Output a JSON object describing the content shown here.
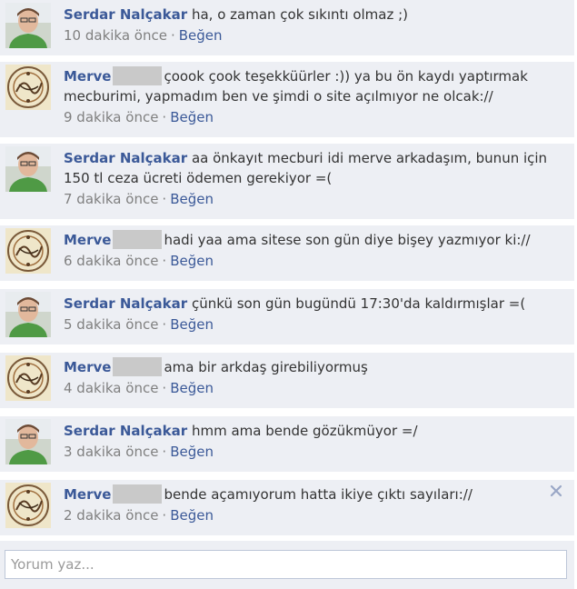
{
  "comments": [
    {
      "author": "Serdar Nalçakar",
      "avatar": "profile-photo-man-green-shirt",
      "redacted": false,
      "text": "ha, o zaman çok sıkıntı olmaz ;)",
      "time": "10 dakika önce",
      "separator": "·",
      "like": "Beğen"
    },
    {
      "author": "Merve",
      "avatar": "profile-photo-ornate-calligraphy",
      "redacted": true,
      "text": "çoook çook teşekküürler :)) ya bu ön kaydı yaptırmak mecburimi, yapmadım ben ve şimdi o site açılmıyor ne olcak://",
      "time": "9 dakika önce",
      "separator": "·",
      "like": "Beğen"
    },
    {
      "author": "Serdar Nalçakar",
      "avatar": "profile-photo-man-green-shirt",
      "redacted": false,
      "text": "aa önkayıt mecburi idi merve arkadaşım, bunun için 150 tl ceza ücreti ödemen gerekiyor =(",
      "time": "7 dakika önce",
      "separator": "·",
      "like": "Beğen"
    },
    {
      "author": "Merve",
      "avatar": "profile-photo-ornate-calligraphy",
      "redacted": true,
      "text": "hadi yaa ama sitese son gün diye bişey yazmıyor ki://",
      "time": "6 dakika önce",
      "separator": "·",
      "like": "Beğen"
    },
    {
      "author": "Serdar Nalçakar",
      "avatar": "profile-photo-man-green-shirt",
      "redacted": false,
      "text": "çünkü son gün bugündü 17:30'da kaldırmışlar =(",
      "time": "5 dakika önce",
      "separator": "·",
      "like": "Beğen"
    },
    {
      "author": "Merve",
      "avatar": "profile-photo-ornate-calligraphy",
      "redacted": true,
      "text": "ama bir arkdaş girebiliyormuş",
      "time": "4 dakika önce",
      "separator": "·",
      "like": "Beğen"
    },
    {
      "author": "Serdar Nalçakar",
      "avatar": "profile-photo-man-green-shirt",
      "redacted": false,
      "text": "hmm ama bende gözükmüyor =/",
      "time": "3 dakika önce",
      "separator": "·",
      "like": "Beğen"
    },
    {
      "author": "Merve",
      "avatar": "profile-photo-ornate-calligraphy",
      "redacted": true,
      "text": "bende açamıyorum hatta ikiye çıktı sayıları://",
      "time": "2 dakika önce",
      "separator": "·",
      "like": "Beğen",
      "close_icon": "close-x-icon"
    }
  ],
  "composer": {
    "placeholder": "Yorum yaz..."
  },
  "colors": {
    "comment_bg": "#edeff4",
    "link_blue": "#3b5998",
    "meta_gray": "#808080",
    "text": "#333333",
    "redaction": "#c9c9c9",
    "close_icon": "#9aa7c6"
  }
}
